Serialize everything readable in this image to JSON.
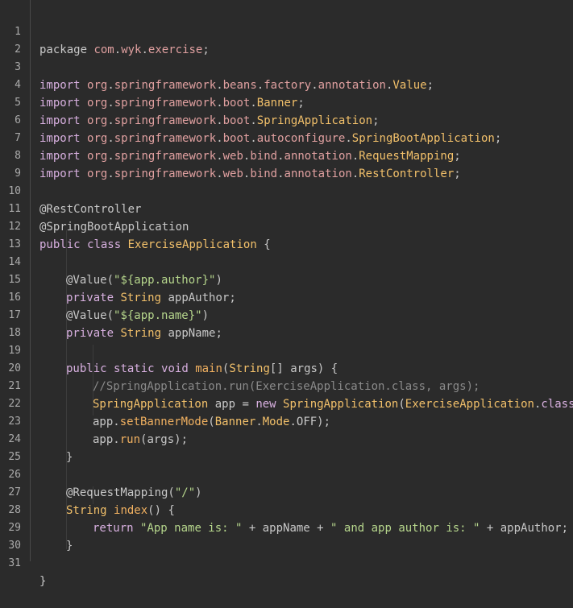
{
  "line_numbers": [
    "1",
    "2",
    "3",
    "4",
    "5",
    "6",
    "7",
    "8",
    "9",
    "10",
    "11",
    "12",
    "13",
    "14",
    "15",
    "16",
    "17",
    "18",
    "19",
    "20",
    "21",
    "22",
    "23",
    "24",
    "25",
    "26",
    "27",
    "28",
    "29",
    "30",
    "31"
  ],
  "code": {
    "l1": [
      "package",
      " ",
      "com",
      ".",
      "wyk",
      ".",
      "exercise",
      ";"
    ],
    "l3": [
      "import",
      " ",
      "org",
      ".",
      "springframework",
      ".",
      "beans",
      ".",
      "factory",
      ".",
      "annotation",
      ".",
      "Value",
      ";"
    ],
    "l4": [
      "import",
      " ",
      "org",
      ".",
      "springframework",
      ".",
      "boot",
      ".",
      "Banner",
      ";"
    ],
    "l5": [
      "import",
      " ",
      "org",
      ".",
      "springframework",
      ".",
      "boot",
      ".",
      "SpringApplication",
      ";"
    ],
    "l6": [
      "import",
      " ",
      "org",
      ".",
      "springframework",
      ".",
      "boot",
      ".",
      "autoconfigure",
      ".",
      "SpringBootApplication",
      ";"
    ],
    "l7": [
      "import",
      " ",
      "org",
      ".",
      "springframework",
      ".",
      "web",
      ".",
      "bind",
      ".",
      "annotation",
      ".",
      "RequestMapping",
      ";"
    ],
    "l8": [
      "import",
      " ",
      "org",
      ".",
      "springframework",
      ".",
      "web",
      ".",
      "bind",
      ".",
      "annotation",
      ".",
      "RestController",
      ";"
    ],
    "l10": [
      "@RestController"
    ],
    "l11": [
      "@SpringBootApplication"
    ],
    "l12": [
      "public",
      " ",
      "class",
      " ",
      "ExerciseApplication",
      " {"
    ],
    "l14": [
      "@Value(",
      "\"${app.author}\"",
      ")"
    ],
    "l15": [
      "private",
      " ",
      "String",
      " appAuthor;"
    ],
    "l16": [
      "@Value(",
      "\"${app.name}\"",
      ")"
    ],
    "l17": [
      "private",
      " ",
      "String",
      " appName;"
    ],
    "l19": [
      "public",
      " ",
      "static",
      " ",
      "void",
      " ",
      "main",
      "(",
      "String",
      "[] args) {"
    ],
    "l20": [
      "//SpringApplication.run(ExerciseApplication.class, args);"
    ],
    "l21": [
      "SpringApplication",
      " app = ",
      "new",
      " ",
      "SpringApplication",
      "(",
      "ExerciseApplication",
      ".",
      "class",
      ")"
    ],
    "l22": [
      "app.",
      "setBannerMode",
      "(",
      "Banner",
      ".",
      "Mode",
      ".OFF);"
    ],
    "l23": [
      "app.",
      "run",
      "(args);"
    ],
    "l24": [
      "}"
    ],
    "l26": [
      "@RequestMapping(",
      "\"/\"",
      ")"
    ],
    "l27": [
      "String",
      " ",
      "index",
      "() {"
    ],
    "l28": [
      "return",
      " ",
      "\"App name is: \"",
      " + appName + ",
      "\" and app author is: \"",
      " + appAuthor;"
    ],
    "l29": [
      "}"
    ],
    "l31": [
      "}"
    ]
  },
  "colors": {
    "background": "#2b2b2b",
    "keyword": "#d8b0e0",
    "package": "#e0a0a0",
    "class": "#f2c06a",
    "string": "#b6d68c",
    "comment": "#8a8a8a",
    "line_number": "#aaaaaa"
  }
}
